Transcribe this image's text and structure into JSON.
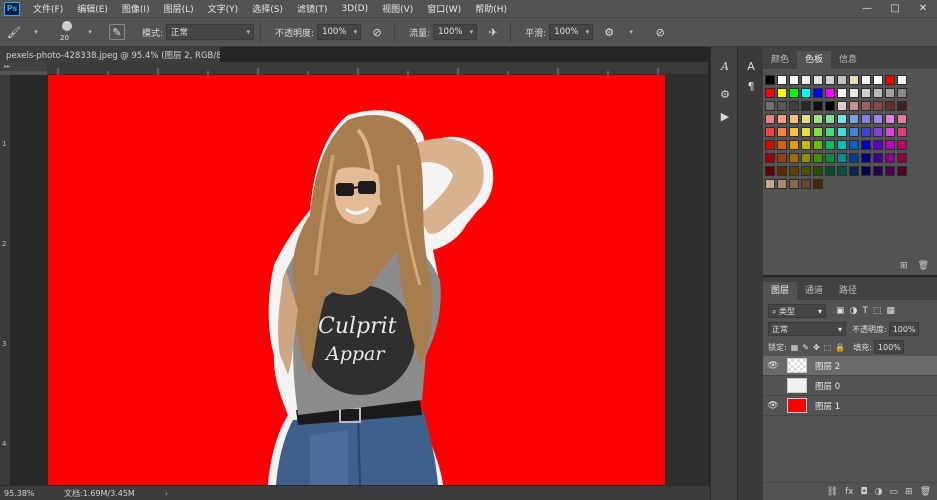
{
  "app": {
    "logo_text": "Ps",
    "menu": [
      "文件(F)",
      "编辑(E)",
      "图像(I)",
      "图层(L)",
      "文字(Y)",
      "选择(S)",
      "滤镜(T)",
      "3D(D)",
      "视图(V)",
      "窗口(W)",
      "帮助(H)"
    ],
    "window_controls": {
      "minimize": "—",
      "maximize": "□",
      "close": "✕"
    }
  },
  "options_bar": {
    "brush_size": "20",
    "mode_label": "模式:",
    "mode_value": "正常",
    "opacity_label": "不透明度:",
    "opacity_value": "100%",
    "flow_label": "流量:",
    "flow_value": "100%",
    "smoothing_label": "平滑:",
    "smoothing_value": "100%"
  },
  "document": {
    "tab_title": "pexels-photo-428338.jpeg @ 95.4% (图层 2, RGB/8) *",
    "close_glyph": "×",
    "ruler_left_labels": [
      "1",
      "2",
      "3",
      "4"
    ],
    "canvas_color": "#ff0000",
    "photo_text_line1": "Culprit",
    "photo_text_line2": "Appar"
  },
  "status_bar": {
    "zoom": "95.38%",
    "doc_info": "文档:1.69M/3.45M",
    "arrow": "›"
  },
  "colors": {
    "foreground": "#f40000",
    "background": "#e21414",
    "accent": "#31a8ff"
  },
  "swatches_panel": {
    "tabs": [
      "颜色",
      "色板",
      "信息"
    ],
    "active_tab": "色板"
  },
  "layers_panel": {
    "tabs": [
      "图层",
      "通道",
      "路径"
    ],
    "filter_label": "类型",
    "blend_mode": "正常",
    "opacity_label": "不透明度:",
    "opacity_value": "100%",
    "lock_label": "锁定:",
    "fill_label": "填充:",
    "fill_value": "100%",
    "layers": [
      {
        "name": "图层 2",
        "visible": true,
        "selected": true
      },
      {
        "name": "图层 0",
        "visible": false,
        "selected": false
      },
      {
        "name": "图层 1",
        "visible": true,
        "selected": false
      }
    ]
  }
}
